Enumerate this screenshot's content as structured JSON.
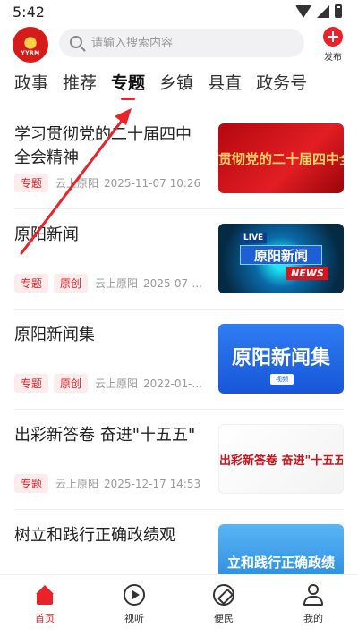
{
  "status_bar": {
    "time": "5:42"
  },
  "header": {
    "logo_text": "YYRM",
    "search_placeholder": "请输入搜索内容",
    "publish_label": "发布"
  },
  "tabs": [
    {
      "label": "政事",
      "active": false
    },
    {
      "label": "推荐",
      "active": false
    },
    {
      "label": "专题",
      "active": true
    },
    {
      "label": "乡镇",
      "active": false
    },
    {
      "label": "县直",
      "active": false
    },
    {
      "label": "政务号",
      "active": false
    }
  ],
  "feed": [
    {
      "title": "学习贯彻党的二十届四中全会精神",
      "tags": [
        "专题"
      ],
      "source": "云上原阳",
      "time": "2025-11-07 10:26",
      "thumb_text": "贯彻党的二十届四中全会"
    },
    {
      "title": "原阳新闻",
      "tags": [
        "专题",
        "原创"
      ],
      "source": "云上原阳",
      "time": "2025-07-...",
      "thumb_live": "LIVE",
      "thumb_text": "原阳新闻",
      "thumb_news": "NEWS"
    },
    {
      "title": "原阳新闻集",
      "tags": [
        "专题",
        "原创"
      ],
      "source": "云上原阳",
      "time": "2022-01-...",
      "thumb_text": "原阳新闻集",
      "thumb_sub": "视频"
    },
    {
      "title": "出彩新答卷 奋进\"十五五\"",
      "tags": [
        "专题"
      ],
      "source": "云上原阳",
      "time": "2025-12-17 14:53",
      "thumb_text": "出彩新答卷 奋进\"十五五\""
    },
    {
      "title": "树立和践行正确政绩观",
      "tags": [],
      "source": "",
      "time": "",
      "thumb_text": "立和践行正确政绩"
    }
  ],
  "bottom_nav": [
    {
      "label": "首页",
      "icon": "home-icon",
      "active": true
    },
    {
      "label": "视听",
      "icon": "video-icon",
      "active": false
    },
    {
      "label": "便民",
      "icon": "compass-icon",
      "active": false
    },
    {
      "label": "我的",
      "icon": "user-icon",
      "active": false
    }
  ],
  "colors": {
    "accent": "#e8232a",
    "tag_bg": "#fdecec",
    "muted": "#999999"
  }
}
